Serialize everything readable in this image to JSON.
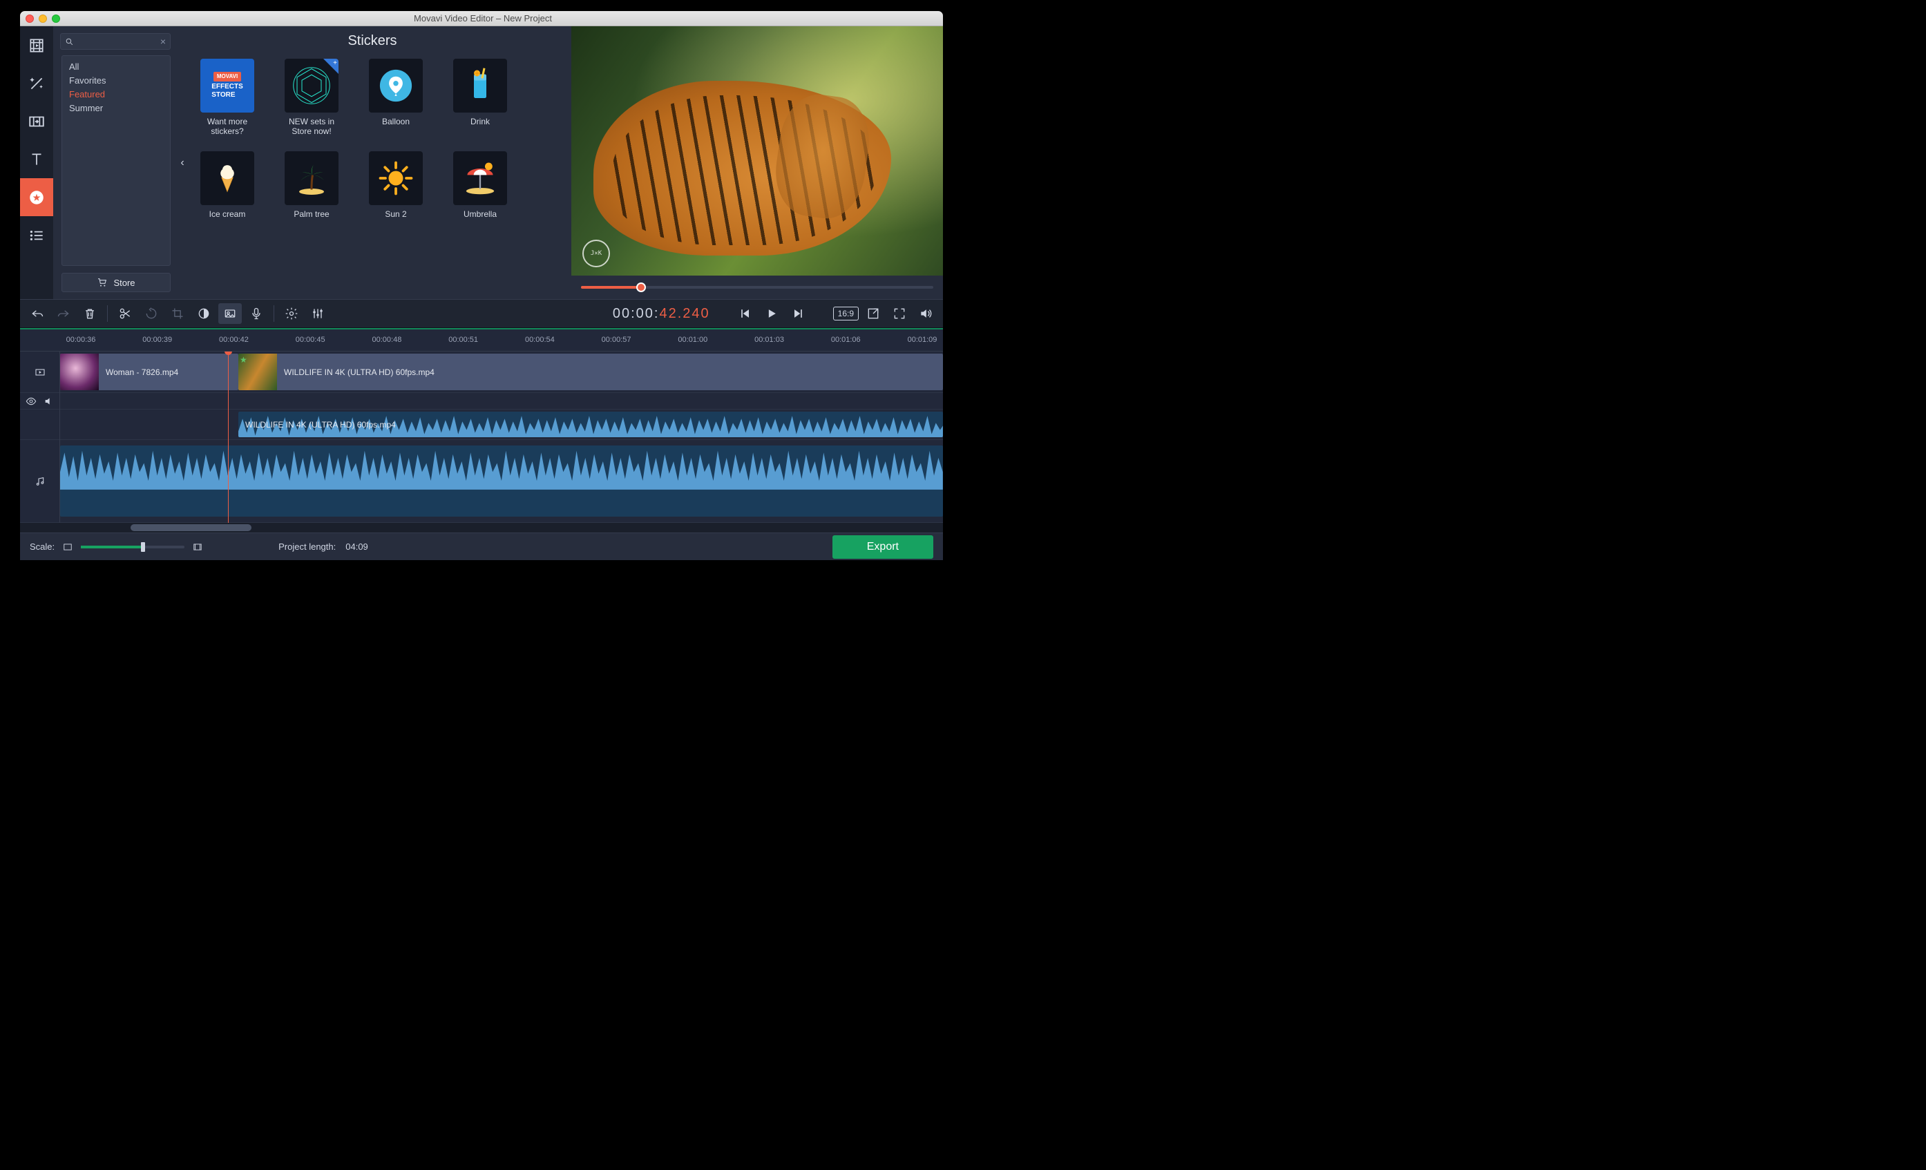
{
  "window": {
    "title": "Movavi Video Editor – New Project"
  },
  "leftTabs": [
    {
      "name": "media",
      "icon": "film"
    },
    {
      "name": "filters",
      "icon": "wand"
    },
    {
      "name": "transitions",
      "icon": "transition"
    },
    {
      "name": "titles",
      "icon": "text"
    },
    {
      "name": "stickers",
      "icon": "sticker",
      "active": true
    },
    {
      "name": "more",
      "icon": "list"
    }
  ],
  "stickers": {
    "title": "Stickers",
    "categories": [
      {
        "label": "All"
      },
      {
        "label": "Favorites"
      },
      {
        "label": "Featured",
        "selected": true
      },
      {
        "label": "Summer"
      }
    ],
    "storeButton": "Store",
    "items": [
      {
        "label": "Want more stickers?",
        "kind": "store1"
      },
      {
        "label": "NEW sets in Store now!",
        "kind": "store2"
      },
      {
        "label": "Balloon",
        "kind": "balloon"
      },
      {
        "label": "Drink",
        "kind": "drink"
      },
      {
        "label": "Ice cream",
        "kind": "icecream"
      },
      {
        "label": "Palm tree",
        "kind": "palm"
      },
      {
        "label": "Sun 2",
        "kind": "sun"
      },
      {
        "label": "Umbrella",
        "kind": "umbrella"
      }
    ]
  },
  "preview": {
    "aspectLabel": "16:9"
  },
  "timecode": {
    "gray": "00:00:",
    "orange": "42.240"
  },
  "ruler": {
    "labels": [
      "00:00:36",
      "00:00:39",
      "00:00:42",
      "00:00:45",
      "00:00:48",
      "00:00:51",
      "00:00:54",
      "00:00:57",
      "00:01:00",
      "00:01:03",
      "00:01:06",
      "00:01:09"
    ]
  },
  "clips": {
    "video1": {
      "label": "Woman - 7826.mp4"
    },
    "video2": {
      "label": "WILDLIFE IN 4K (ULTRA HD) 60fps.mp4"
    },
    "audio1": {
      "label": "WILDLIFE IN 4K (ULTRA HD) 60fps.mp4"
    }
  },
  "footer": {
    "scaleLabel": "Scale:",
    "projectLengthLabel": "Project length:",
    "projectLengthValue": "04:09",
    "exportLabel": "Export"
  }
}
